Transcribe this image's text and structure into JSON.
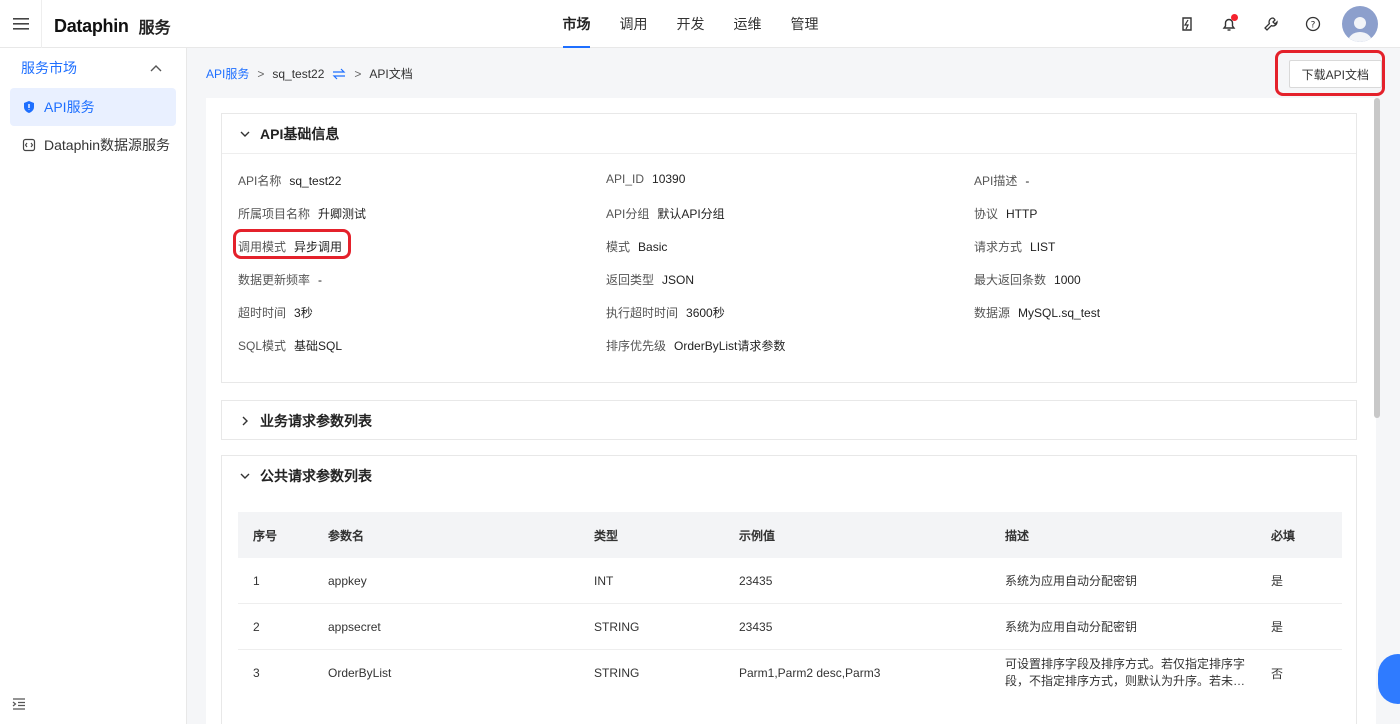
{
  "header": {
    "brand": "Dataphin",
    "product": "服务",
    "nav": [
      "市场",
      "调用",
      "开发",
      "运维",
      "管理"
    ],
    "active_nav": "市场"
  },
  "sidebar": {
    "group": "服务市场",
    "items": [
      {
        "label": "API服务",
        "active": true
      },
      {
        "label": "Dataphin数据源服务",
        "active": false
      }
    ]
  },
  "breadcrumb": {
    "root": "API服务",
    "sep1": ">",
    "api": "sq_test22",
    "sep2": ">",
    "current": "API文档"
  },
  "download_button": "下载API文档",
  "basic_info": {
    "title": "API基础信息",
    "rows": [
      [
        {
          "label": "API名称",
          "value": "sq_test22"
        },
        {
          "label": "API_ID",
          "value": "10390"
        },
        {
          "label": "API描述",
          "value": "-"
        }
      ],
      [
        {
          "label": "所属项目名称",
          "value": "升卿测试"
        },
        {
          "label": "API分组",
          "value": "默认API分组"
        },
        {
          "label": "协议",
          "value": "HTTP"
        }
      ],
      [
        {
          "label": "调用模式",
          "value": "异步调用"
        },
        {
          "label": "模式",
          "value": "Basic"
        },
        {
          "label": "请求方式",
          "value": "LIST"
        }
      ],
      [
        {
          "label": "数据更新频率",
          "value": "-"
        },
        {
          "label": "返回类型",
          "value": "JSON"
        },
        {
          "label": "最大返回条数",
          "value": "1000"
        }
      ],
      [
        {
          "label": "超时时间",
          "value": "3秒"
        },
        {
          "label": "执行超时时间",
          "value": "3600秒"
        },
        {
          "label": "数据源",
          "value": "MySQL.sq_test"
        }
      ],
      [
        {
          "label": "SQL模式",
          "value": "基础SQL"
        },
        {
          "label": "排序优先级",
          "value": "OrderByList请求参数"
        }
      ]
    ]
  },
  "business_params": {
    "title": "业务请求参数列表"
  },
  "public_params": {
    "title": "公共请求参数列表",
    "columns": [
      "序号",
      "参数名",
      "类型",
      "示例值",
      "描述",
      "必填"
    ],
    "rows": [
      [
        "1",
        "appkey",
        "INT",
        "23435",
        "系统为应用自动分配密钥",
        "是"
      ],
      [
        "2",
        "appsecret",
        "STRING",
        "23435",
        "系统为应用自动分配密钥",
        "是"
      ],
      [
        "3",
        "OrderByList",
        "STRING",
        "Parm1,Parm2 desc,Parm3",
        "可设置排序字段及排序方式。若仅指定排序字段，不指定排序方式，则默认为升序。若未…",
        "否"
      ]
    ]
  },
  "colors": {
    "accent": "#1e6fff",
    "highlight": "#e4212b"
  }
}
